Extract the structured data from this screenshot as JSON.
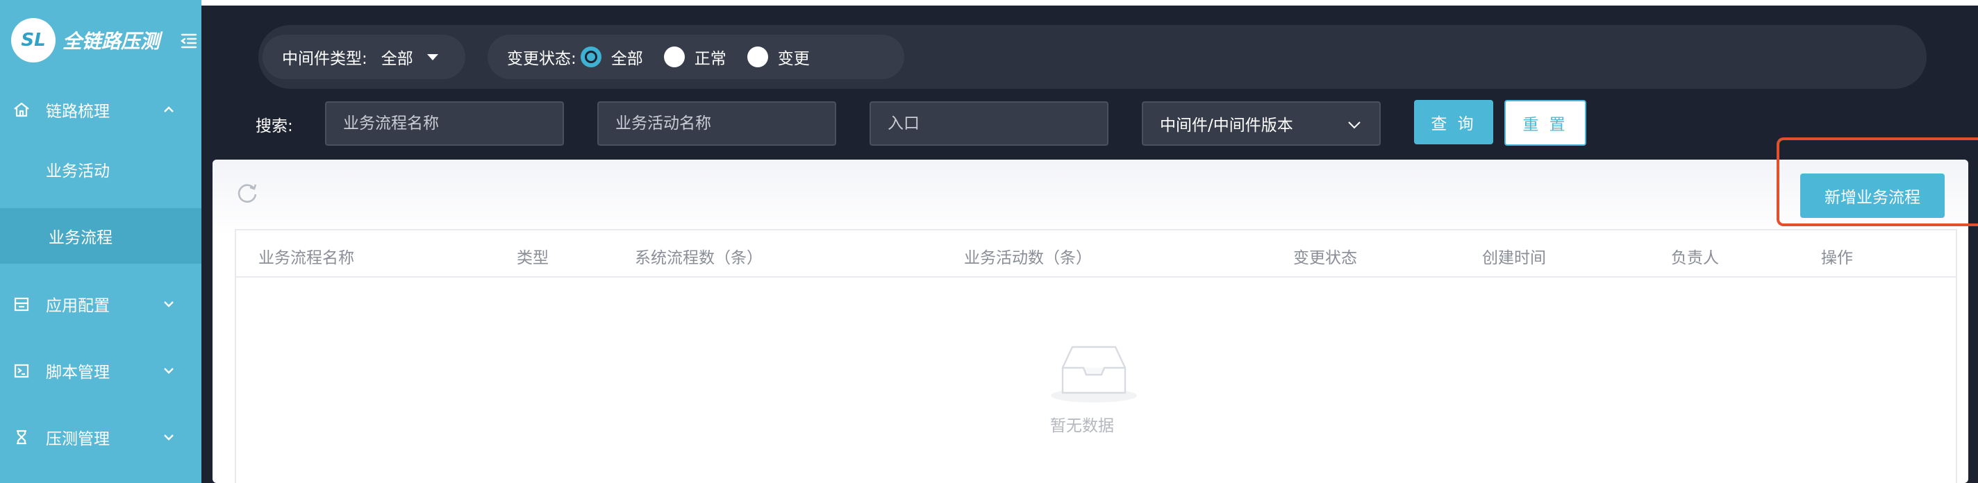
{
  "app": {
    "logo_initials": "SL",
    "logo_text": "全链路压测"
  },
  "sidebar": {
    "groups": [
      {
        "label": "链路梳理",
        "icon": "home-icon",
        "expanded": true,
        "children": [
          {
            "label": "业务活动",
            "active": false
          },
          {
            "label": "业务流程",
            "active": true
          }
        ]
      },
      {
        "label": "应用配置",
        "icon": "app-config-icon",
        "expanded": false
      },
      {
        "label": "脚本管理",
        "icon": "terminal-icon",
        "expanded": false
      },
      {
        "label": "压测管理",
        "icon": "hourglass-icon",
        "expanded": false
      }
    ]
  },
  "filters": {
    "middleware_type": {
      "label": "中间件类型:",
      "value": "全部"
    },
    "change_status": {
      "label": "变更状态:",
      "options": [
        {
          "label": "全部",
          "checked": true
        },
        {
          "label": "正常",
          "checked": false
        },
        {
          "label": "变更",
          "checked": false
        }
      ]
    }
  },
  "search": {
    "label": "搜索:",
    "process_name_placeholder": "业务流程名称",
    "activity_name_placeholder": "业务活动名称",
    "entry_placeholder": "入口",
    "middleware_version_placeholder": "中间件/中间件版本",
    "query_label": "查 询",
    "reset_label": "重 置"
  },
  "toolbar": {
    "add_label": "新增业务流程"
  },
  "table": {
    "columns": [
      "业务流程名称",
      "类型",
      "系统流程数（条）",
      "业务活动数（条）",
      "变更状态",
      "创建时间",
      "负责人",
      "操作"
    ],
    "rows": [],
    "empty_text": "暂无数据"
  },
  "colors": {
    "sidebar": "#57b9d6",
    "accent": "#4cb7d6",
    "main_bg": "#1d2230",
    "highlight": "#e2502e"
  }
}
